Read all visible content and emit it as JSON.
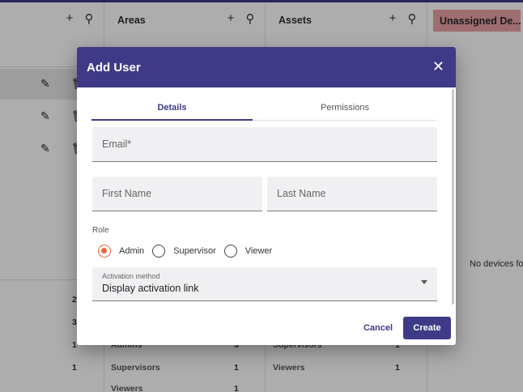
{
  "background": {
    "panels": [
      {
        "title": "",
        "icons": [
          "add-icon",
          "search-icon"
        ]
      },
      {
        "title": "Areas",
        "icons": [
          "add-icon",
          "search-icon"
        ]
      },
      {
        "title": "Assets",
        "icons": [
          "add-icon",
          "search-icon"
        ]
      }
    ],
    "unassigned_chip": "Unassigned De...",
    "no_devices_text": "No devices fo",
    "summary_numbers_col1": [
      "2",
      "3",
      "1",
      "1"
    ],
    "summary_rows_col2": [
      {
        "label": "Admins",
        "count": "3"
      },
      {
        "label": "Supervisors",
        "count": "1"
      },
      {
        "label": "Viewers",
        "count": "1"
      }
    ],
    "summary_rows_col3": [
      {
        "label": "Supervisors",
        "count": "1"
      },
      {
        "label": "Viewers",
        "count": "1"
      }
    ],
    "header_color": "#3f3a87",
    "chip_color": "#e9a1a6"
  },
  "dialog": {
    "title": "Add User",
    "close_icon": "close-icon",
    "tabs": [
      {
        "label": "Details",
        "active": true
      },
      {
        "label": "Permissions",
        "active": false
      }
    ],
    "email_placeholder": "Email*",
    "first_name_placeholder": "First Name",
    "last_name_placeholder": "Last Name",
    "role": {
      "label": "Role",
      "options": [
        "Admin",
        "Supervisor",
        "Viewer"
      ],
      "selected": "Admin"
    },
    "activation": {
      "label": "Activation method",
      "value": "Display activation link"
    },
    "cancel_label": "Cancel",
    "create_label": "Create",
    "accent_color": "#3f3a87",
    "radio_checked_color": "#e8663d"
  }
}
